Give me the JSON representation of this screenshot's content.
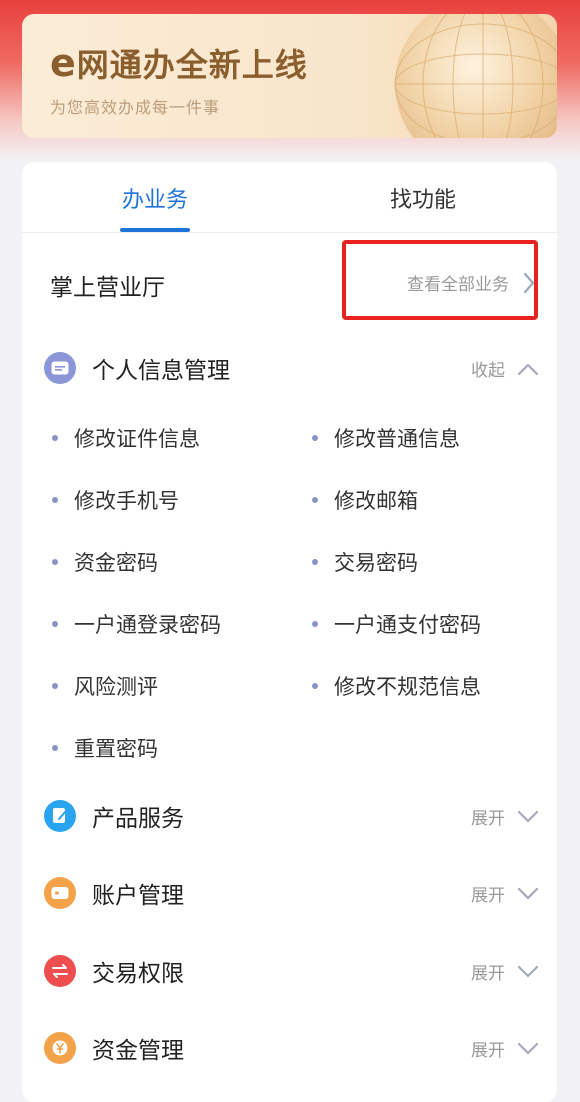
{
  "banner": {
    "title_e": "e",
    "title_rest": "网通办全新上线",
    "subtitle": "为您高效办成每一件事"
  },
  "tabs": [
    {
      "label": "办业务",
      "active": true
    },
    {
      "label": "找功能",
      "active": false
    }
  ],
  "section": {
    "title": "掌上营业厅",
    "view_all": "查看全部业务"
  },
  "groups": [
    {
      "label": "个人信息管理",
      "action": "收起",
      "expanded": true,
      "icon": "id-card-icon",
      "color": "#8b96d6",
      "items": [
        "修改证件信息",
        "修改普通信息",
        "修改手机号",
        "修改邮箱",
        "资金密码",
        "交易密码",
        "一户通登录密码",
        "一户通支付密码",
        "风险测评",
        "修改不规范信息",
        "重置密码"
      ]
    },
    {
      "label": "产品服务",
      "action": "展开",
      "expanded": false,
      "icon": "document-icon",
      "color": "#2aa3f0"
    },
    {
      "label": "账户管理",
      "action": "展开",
      "expanded": false,
      "icon": "wallet-icon",
      "color": "#f4a24a"
    },
    {
      "label": "交易权限",
      "action": "展开",
      "expanded": false,
      "icon": "exchange-icon",
      "color": "#ef4e4e"
    },
    {
      "label": "资金管理",
      "action": "展开",
      "expanded": false,
      "icon": "yen-coin-icon",
      "color": "#f4a24a"
    }
  ],
  "colors": {
    "accent": "#1e73d9",
    "highlight": "#e8231f",
    "bullet": "#8a94c4"
  }
}
